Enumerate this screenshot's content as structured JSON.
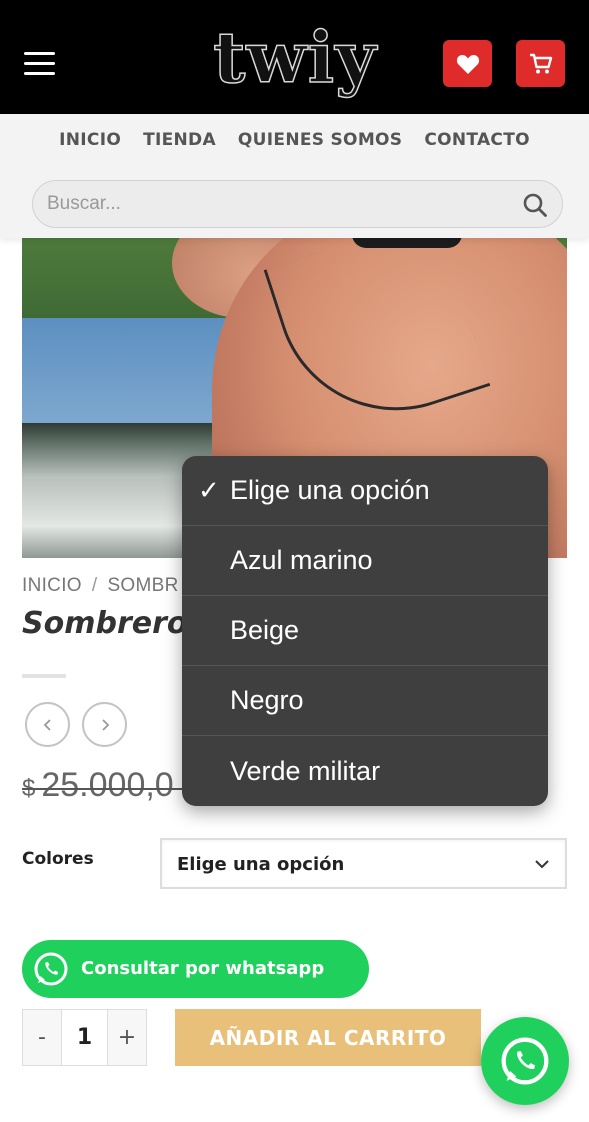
{
  "header": {
    "logo_text": "twiy",
    "menu_icon": "hamburger-menu-icon",
    "wishlist_icon": "heart-icon",
    "cart_icon": "shopping-cart-icon",
    "accent_color": "#e02b2b"
  },
  "nav": {
    "items": [
      "INICIO",
      "TIENDA",
      "QUIENES SOMOS",
      "CONTACTO"
    ]
  },
  "search": {
    "placeholder": "Buscar...",
    "icon": "search-icon"
  },
  "product": {
    "breadcrumb": [
      "INICIO",
      "SOMBR"
    ],
    "title": "Sombrero",
    "price_currency": "$",
    "price_value": "25.000,0",
    "prev_icon": "chevron-left-icon",
    "next_icon": "chevron-right-icon"
  },
  "variation": {
    "label": "Colores",
    "selected": "Elige una opción",
    "options": [
      {
        "label": "Elige una opción",
        "checked": true
      },
      {
        "label": "Azul marino",
        "checked": false
      },
      {
        "label": "Beige",
        "checked": false
      },
      {
        "label": "Negro",
        "checked": false
      },
      {
        "label": "Verde militar",
        "checked": false
      }
    ]
  },
  "whatsapp_button": {
    "label": "Consultar por whatsapp",
    "color": "#1fd15c"
  },
  "cart": {
    "minus": "-",
    "quantity": "1",
    "plus": "+",
    "add_label": "AÑADIR AL CARRITO",
    "add_color": "#e8c07a"
  }
}
